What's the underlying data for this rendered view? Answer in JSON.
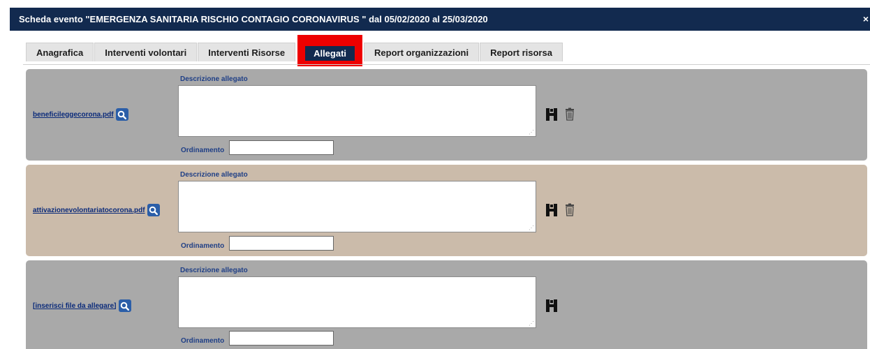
{
  "window": {
    "title": "Scheda evento \"EMERGENZA SANITARIA RISCHIO CONTAGIO CORONAVIRUS \" dal 05/02/2020 al 25/03/2020",
    "close_glyph": "×"
  },
  "tabs": [
    {
      "label": "Anagrafica",
      "active": false
    },
    {
      "label": "Interventi volontari",
      "active": false
    },
    {
      "label": "Interventi Risorse",
      "active": false
    },
    {
      "label": "Allegati",
      "active": true
    },
    {
      "label": "Report organizzazioni",
      "active": false
    },
    {
      "label": "Report risorsa",
      "active": false
    }
  ],
  "attachments": [
    {
      "file_label": "beneficileggecorona.pdf",
      "description_label": "Descrizione allegato",
      "description_value": "",
      "order_label": "Ordinamento",
      "order_value": "",
      "background": "#a9a9a9",
      "has_delete": true
    },
    {
      "file_label": "attivazionevolontariatocorona.pdf",
      "description_label": "Descrizione allegato",
      "description_value": "",
      "order_label": "Ordinamento",
      "order_value": "",
      "background": "#cbbbaa",
      "has_delete": true
    },
    {
      "file_label": "[inserisci file da allegare]",
      "description_label": "Descrizione allegato",
      "description_value": "",
      "order_label": "Ordinamento",
      "order_value": "",
      "background": "#a9a9a9",
      "has_delete": false
    }
  ],
  "icons": {
    "search": "magnifier-icon",
    "save": "save-icon",
    "delete": "trash-icon"
  },
  "colors": {
    "titlebar": "#122a4f",
    "active_tab_highlight": "#ee0000",
    "label_blue": "#1f3f86"
  }
}
